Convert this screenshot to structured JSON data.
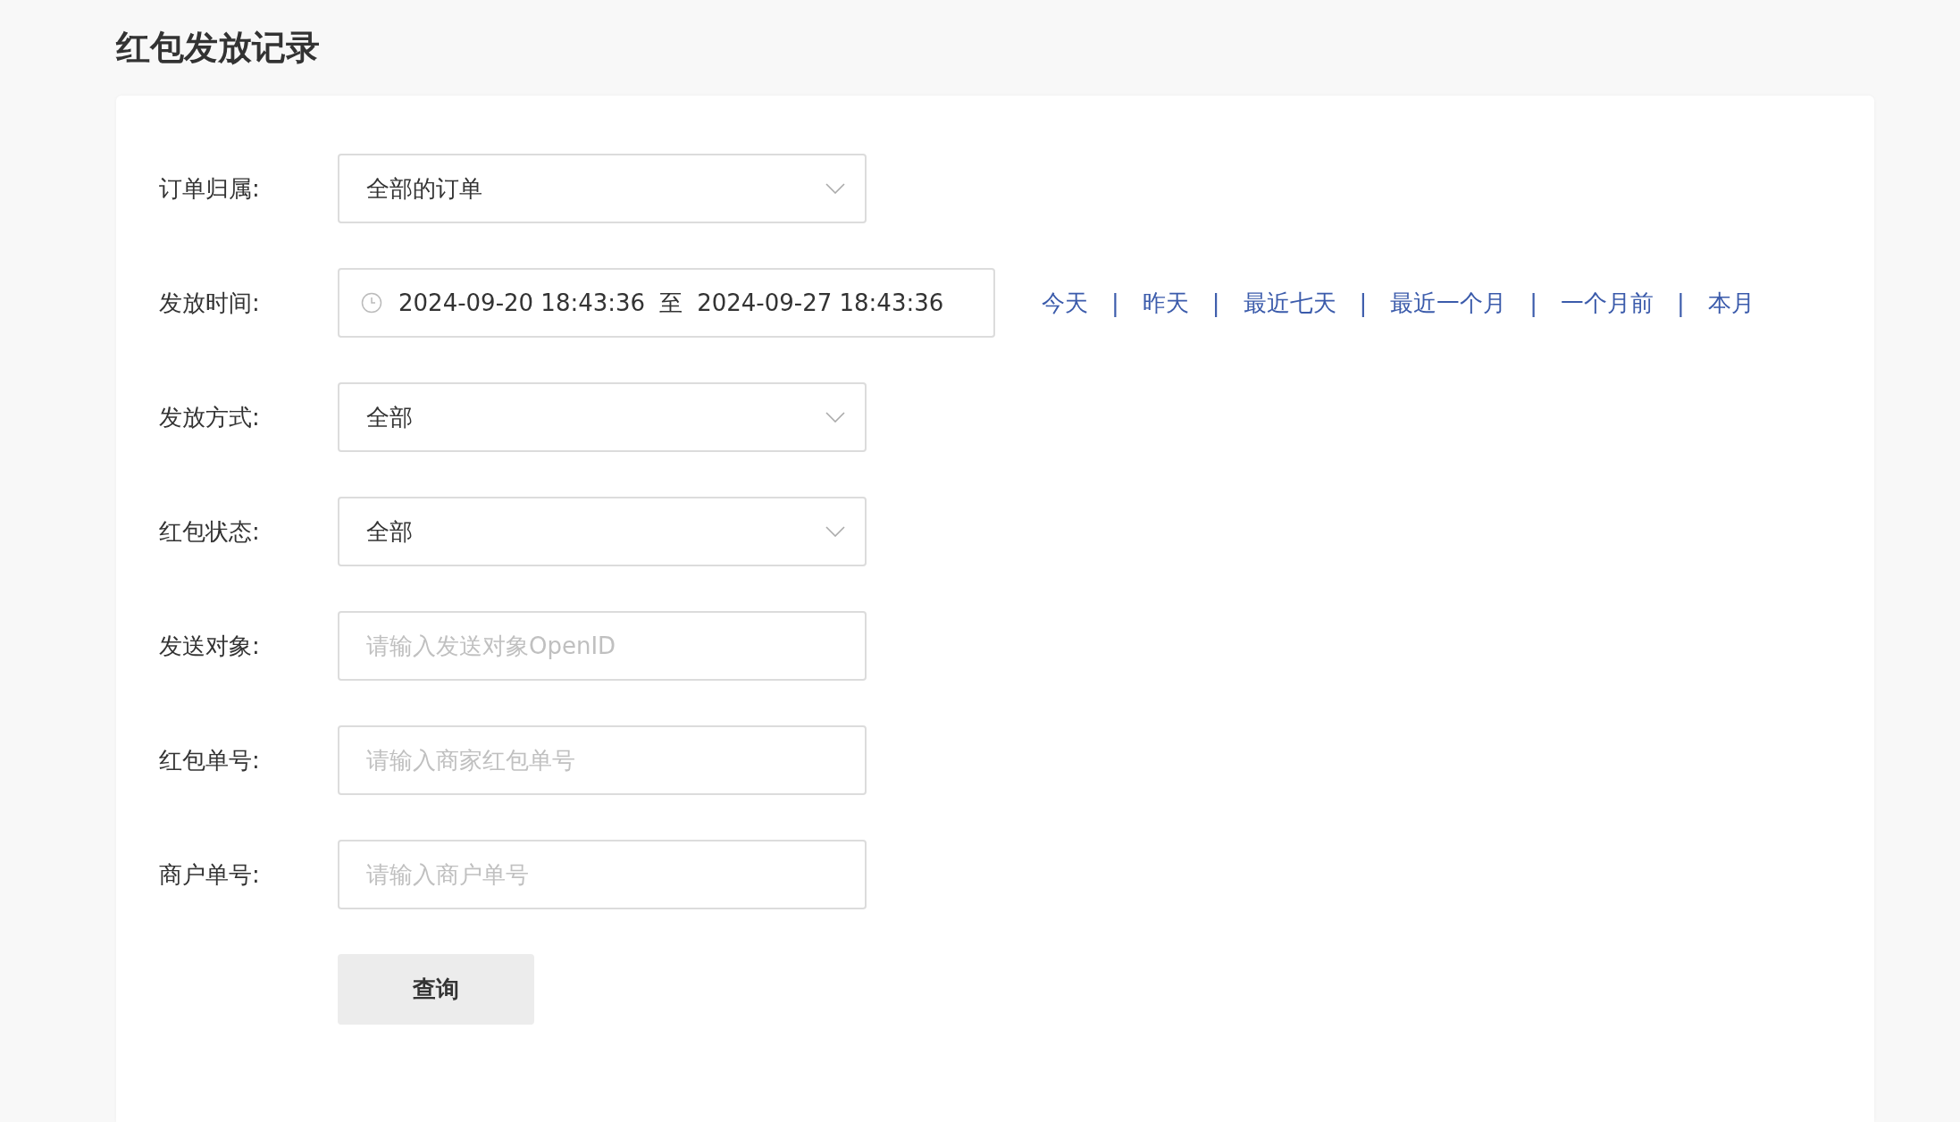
{
  "title": "红包发放记录",
  "fields": [
    {
      "kind": "select",
      "label": "订单归属:",
      "value": "全部的订单"
    },
    {
      "kind": "daterange",
      "label": "发放时间:",
      "start": "2024-09-20 18:43:36",
      "connector": "至",
      "end": "2024-09-27 18:43:36",
      "quick_ranges": [
        "今天",
        "昨天",
        "最近七天",
        "最近一个月",
        "一个月前",
        "本月"
      ],
      "separator": "|"
    },
    {
      "kind": "select",
      "label": "发放方式:",
      "value": "全部"
    },
    {
      "kind": "select",
      "label": "红包状态:",
      "value": "全部"
    },
    {
      "kind": "input",
      "label": "发送对象:",
      "placeholder": "请输入发送对象OpenID"
    },
    {
      "kind": "input",
      "label": "红包单号:",
      "placeholder": "请输入商家红包单号"
    },
    {
      "kind": "input",
      "label": "商户单号:",
      "placeholder": "请输入商户单号"
    }
  ],
  "submit": "查询"
}
